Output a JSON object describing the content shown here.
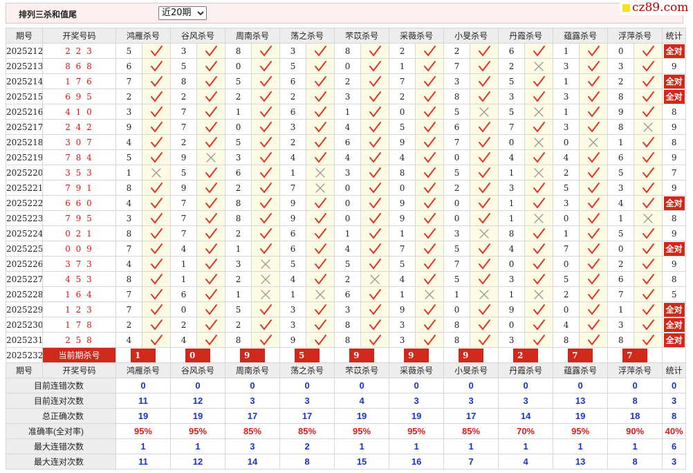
{
  "header": {
    "title": "排列三杀和值尾",
    "select_value": "近20期"
  },
  "logo": {
    "text": "cz89.com"
  },
  "columns": {
    "period": "期号",
    "draw": "开奖号码",
    "stat": "统计"
  },
  "experts": [
    "鸿雁杀号",
    "谷风杀号",
    "周南杀号",
    "荡之杀号",
    "芣苡杀号",
    "采薇杀号",
    "小旻杀号",
    "丹霞杀号",
    "蕴露杀号",
    "浮萍杀号"
  ],
  "rows": [
    {
      "p": "2025212",
      "d": "2 2 3",
      "n": [
        5,
        3,
        8,
        3,
        8,
        2,
        2,
        6,
        1,
        0
      ],
      "r": [
        1,
        1,
        1,
        1,
        1,
        1,
        1,
        1,
        1,
        1
      ],
      "s": "全对"
    },
    {
      "p": "2025213",
      "d": "8 6 8",
      "n": [
        6,
        5,
        0,
        5,
        0,
        1,
        7,
        2,
        3,
        3
      ],
      "r": [
        1,
        1,
        1,
        1,
        1,
        1,
        1,
        0,
        1,
        1
      ],
      "s": "9"
    },
    {
      "p": "2025214",
      "d": "1 7 6",
      "n": [
        7,
        8,
        5,
        6,
        2,
        7,
        3,
        5,
        1,
        2
      ],
      "r": [
        1,
        1,
        1,
        1,
        1,
        1,
        1,
        1,
        1,
        1
      ],
      "s": "全对"
    },
    {
      "p": "2025215",
      "d": "6 9 5",
      "n": [
        2,
        2,
        2,
        2,
        3,
        2,
        8,
        3,
        3,
        8
      ],
      "r": [
        1,
        1,
        1,
        1,
        1,
        1,
        1,
        1,
        1,
        1
      ],
      "s": "全对"
    },
    {
      "p": "2025216",
      "d": "4 1 0",
      "n": [
        3,
        7,
        1,
        6,
        1,
        0,
        5,
        5,
        1,
        9
      ],
      "r": [
        1,
        1,
        1,
        1,
        1,
        1,
        0,
        0,
        1,
        1
      ],
      "s": "8"
    },
    {
      "p": "2025217",
      "d": "2 4 2",
      "n": [
        9,
        7,
        0,
        3,
        4,
        5,
        6,
        7,
        3,
        8
      ],
      "r": [
        1,
        1,
        1,
        1,
        1,
        1,
        1,
        1,
        1,
        0
      ],
      "s": "9"
    },
    {
      "p": "2025218",
      "d": "3 0 7",
      "n": [
        4,
        2,
        5,
        2,
        6,
        9,
        7,
        0,
        0,
        1
      ],
      "r": [
        1,
        1,
        1,
        1,
        1,
        1,
        1,
        0,
        0,
        1
      ],
      "s": "8"
    },
    {
      "p": "2025219",
      "d": "7 8 4",
      "n": [
        5,
        9,
        3,
        4,
        4,
        4,
        0,
        4,
        4,
        6
      ],
      "r": [
        1,
        0,
        1,
        1,
        1,
        1,
        1,
        1,
        1,
        1
      ],
      "s": "9"
    },
    {
      "p": "2025220",
      "d": "3 5 3",
      "n": [
        1,
        5,
        6,
        1,
        3,
        8,
        5,
        1,
        2,
        5
      ],
      "r": [
        0,
        1,
        1,
        0,
        1,
        1,
        1,
        0,
        1,
        1
      ],
      "s": "7"
    },
    {
      "p": "2025221",
      "d": "7 9 1",
      "n": [
        8,
        9,
        2,
        7,
        0,
        0,
        2,
        3,
        5,
        3
      ],
      "r": [
        1,
        1,
        1,
        0,
        1,
        1,
        1,
        1,
        1,
        1
      ],
      "s": "9"
    },
    {
      "p": "2025222",
      "d": "6 6 0",
      "n": [
        4,
        7,
        8,
        9,
        0,
        9,
        0,
        1,
        3,
        4
      ],
      "r": [
        1,
        1,
        1,
        1,
        1,
        1,
        1,
        1,
        1,
        1
      ],
      "s": "全对"
    },
    {
      "p": "2025223",
      "d": "7 9 5",
      "n": [
        3,
        7,
        8,
        9,
        0,
        9,
        0,
        1,
        0,
        1
      ],
      "r": [
        1,
        1,
        1,
        1,
        1,
        1,
        1,
        0,
        1,
        0
      ],
      "s": "8"
    },
    {
      "p": "2025224",
      "d": "0 2 1",
      "n": [
        8,
        7,
        2,
        6,
        1,
        1,
        3,
        8,
        1,
        5
      ],
      "r": [
        1,
        1,
        1,
        1,
        1,
        1,
        0,
        1,
        1,
        1
      ],
      "s": "9"
    },
    {
      "p": "2025225",
      "d": "0 0 9",
      "n": [
        7,
        4,
        1,
        6,
        4,
        7,
        5,
        4,
        7,
        0
      ],
      "r": [
        1,
        1,
        1,
        1,
        1,
        1,
        1,
        1,
        1,
        1
      ],
      "s": "全对"
    },
    {
      "p": "2025226",
      "d": "3 7 3",
      "n": [
        4,
        1,
        3,
        5,
        5,
        5,
        7,
        0,
        0,
        2
      ],
      "r": [
        1,
        1,
        0,
        1,
        1,
        1,
        1,
        1,
        1,
        1
      ],
      "s": "9"
    },
    {
      "p": "2025227",
      "d": "4 5 3",
      "n": [
        8,
        1,
        2,
        4,
        2,
        4,
        5,
        3,
        5,
        6
      ],
      "r": [
        1,
        1,
        0,
        1,
        0,
        1,
        1,
        1,
        1,
        1
      ],
      "s": "8"
    },
    {
      "p": "2025228",
      "d": "1 6 4",
      "n": [
        7,
        6,
        1,
        1,
        6,
        1,
        1,
        1,
        2,
        7
      ],
      "r": [
        1,
        1,
        0,
        0,
        1,
        0,
        0,
        0,
        1,
        1
      ],
      "s": "5"
    },
    {
      "p": "2025229",
      "d": "1 2 3",
      "n": [
        7,
        0,
        5,
        3,
        3,
        9,
        0,
        9,
        0,
        1
      ],
      "r": [
        1,
        1,
        1,
        1,
        1,
        1,
        1,
        1,
        1,
        1
      ],
      "s": "全对"
    },
    {
      "p": "2025230",
      "d": "1 7 8",
      "n": [
        2,
        2,
        2,
        3,
        8,
        3,
        8,
        0,
        4,
        3
      ],
      "r": [
        1,
        1,
        1,
        1,
        1,
        1,
        1,
        1,
        1,
        1
      ],
      "s": "全对"
    },
    {
      "p": "2025231",
      "d": "2 5 8",
      "n": [
        4,
        4,
        8,
        9,
        8,
        3,
        8,
        3,
        8,
        8
      ],
      "r": [
        1,
        1,
        1,
        1,
        1,
        1,
        1,
        1,
        1,
        1
      ],
      "s": "全对"
    }
  ],
  "current": {
    "period": "2025232",
    "label": "当前期杀号",
    "nums": [
      "1",
      "0",
      "9",
      "5",
      "9",
      "9",
      "9",
      "2",
      "7",
      "7"
    ]
  },
  "stats": [
    {
      "label": "目前连错次数",
      "vals": [
        "0",
        "0",
        "0",
        "0",
        "0",
        "0",
        "0",
        "0",
        "0",
        "0",
        "0"
      ]
    },
    {
      "label": "目前连对次数",
      "vals": [
        "11",
        "12",
        "3",
        "3",
        "4",
        "3",
        "3",
        "3",
        "13",
        "8",
        "3"
      ]
    },
    {
      "label": "总正确次数",
      "vals": [
        "19",
        "19",
        "17",
        "17",
        "19",
        "19",
        "17",
        "14",
        "19",
        "18",
        "8"
      ]
    },
    {
      "label": "准确率(全对率)",
      "vals": [
        "95%",
        "95%",
        "85%",
        "85%",
        "95%",
        "95%",
        "85%",
        "70%",
        "95%",
        "90%",
        "40%"
      ]
    },
    {
      "label": "最大连错次数",
      "vals": [
        "1",
        "1",
        "3",
        "2",
        "1",
        "1",
        "1",
        "1",
        "1",
        "1",
        "6"
      ]
    },
    {
      "label": "最大连对次数",
      "vals": [
        "11",
        "12",
        "14",
        "8",
        "15",
        "16",
        "7",
        "4",
        "13",
        "8",
        "3"
      ]
    }
  ],
  "colors": {
    "accent": "#d1281c",
    "check": "#e0332a",
    "cross": "#999999",
    "stat_blue": "#1733c8"
  }
}
